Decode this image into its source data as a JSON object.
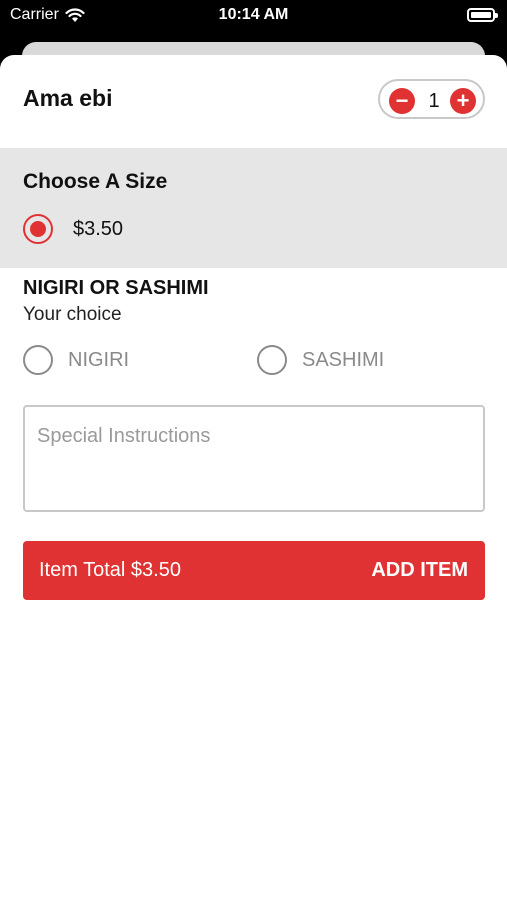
{
  "status_bar": {
    "carrier": "Carrier",
    "time": "10:14 AM",
    "wifi_icon": "wifi-icon",
    "battery_icon": "battery-icon",
    "battery_level": 1.0
  },
  "item": {
    "name": "Ama ebi",
    "quantity": "1",
    "minus_icon": "minus-icon",
    "plus_icon": "plus-icon"
  },
  "size": {
    "heading": "Choose A Size",
    "options": [
      {
        "label": "$3.50",
        "selected": true
      }
    ]
  },
  "choice": {
    "heading": "NIGIRI OR SASHIMI",
    "subheading": "Your choice",
    "options": [
      {
        "label": "NIGIRI",
        "selected": false
      },
      {
        "label": "SASHIMI",
        "selected": false
      }
    ]
  },
  "instructions": {
    "placeholder": "Special Instructions",
    "value": ""
  },
  "footer": {
    "total_label": "Item Total $3.50",
    "add_label": "ADD ITEM"
  },
  "colors": {
    "accent": "#e03232",
    "section_bg": "#e6e6e6"
  }
}
